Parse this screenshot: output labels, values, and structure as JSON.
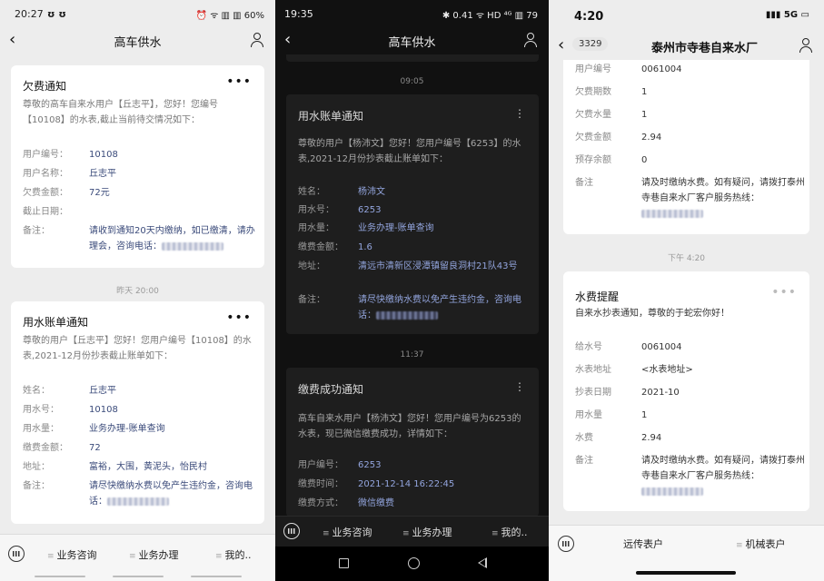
{
  "phone1": {
    "status_time": "20:27",
    "status_left_icons": "ʊ ʊ",
    "status_right": "⏰ ᯤ ▥ ▥ 60%",
    "nav_title": "高车供水",
    "card1": {
      "title": "欠费通知",
      "intro": "尊敬的高车自来水用户【丘志平】，您好！您编号【10108】的水表,截止当前待交情况如下：",
      "rows": [
        {
          "k": "用户编号：",
          "v": "10108"
        },
        {
          "k": "用户名称：",
          "v": "丘志平"
        },
        {
          "k": "欠费金额：",
          "v": "72元"
        },
        {
          "k": "截止日期：",
          "v": ""
        },
        {
          "k": "备注：",
          "v": "请收到通知20天内缴纳，如已缴清，请办理会，咨询电话："
        }
      ]
    },
    "timestamp": "昨天 20:00",
    "card2": {
      "title": "用水账单通知",
      "intro": "尊敬的用户【丘志平】您好！您用户编号【10108】的水表,2021-12月份抄表截止账单如下：",
      "rows": [
        {
          "k": "姓名：",
          "v": "丘志平"
        },
        {
          "k": "用水号：",
          "v": "10108"
        },
        {
          "k": "用水量：",
          "v": "业务办理-账单查询"
        },
        {
          "k": "缴费金额：",
          "v": "72"
        },
        {
          "k": "地址：",
          "v": "富裕，大围，黄泥头，怡民村"
        },
        {
          "k": "备注：",
          "v": "请尽快缴纳水费以免产生违约金，咨询电话："
        }
      ]
    },
    "menus": [
      "业务咨询",
      "业务办理",
      "我的.."
    ]
  },
  "phone2": {
    "status_time": "19:35",
    "status_right": "✱ 0.41 ᯤ HD ⁴ᴳ ▥ 79",
    "nav_title": "高车供水",
    "timestamp1": "09:05",
    "card1": {
      "title": "用水账单通知",
      "intro": "尊敬的用户【杨沛文】您好！您用户编号【6253】的水表,2021-12月份抄表截止账单如下：",
      "rows": [
        {
          "k": "姓名：",
          "v": "杨沛文"
        },
        {
          "k": "用水号：",
          "v": "6253"
        },
        {
          "k": "用水量：",
          "v": "业务办理-账单查询"
        },
        {
          "k": "缴费金额：",
          "v": "1.6"
        },
        {
          "k": "地址：",
          "v": "清远市清新区浸潭镇留良洞村21队43号"
        },
        {
          "k": "备注：",
          "v": "请尽快缴纳水费以免产生违约金，咨询电话："
        }
      ]
    },
    "timestamp2": "11:37",
    "card2": {
      "title": "缴费成功通知",
      "intro": "高车自来水用户【杨沛文】您好！您用户编号为6253的水表，现已微信缴费成功，详情如下：",
      "rows": [
        {
          "k": "用户编号：",
          "v": "6253"
        },
        {
          "k": "缴费时间：",
          "v": "2021-12-14 16:22:45"
        },
        {
          "k": "缴费方式：",
          "v": "微信缴费"
        }
      ]
    },
    "menus": [
      "业务咨询",
      "业务办理",
      "我的.."
    ]
  },
  "phone3": {
    "status_time": "4:20",
    "status_right": "▮▮▮ 5G ▭",
    "badge": "3329",
    "nav_title": "泰州市寺巷自来水厂",
    "card1": {
      "rows": [
        {
          "k": "用户编号",
          "v": "0061004"
        },
        {
          "k": "欠费期数",
          "v": "1"
        },
        {
          "k": "欠费水量",
          "v": "1"
        },
        {
          "k": "欠费金额",
          "v": "2.94"
        },
        {
          "k": "预存余额",
          "v": "0"
        },
        {
          "k": "备注",
          "v": "请及时缴纳水费。如有疑问，请拨打泰州寺巷自来水厂客户服务热线："
        }
      ]
    },
    "timestamp": "下午 4:20",
    "card2": {
      "title": "水费提醒",
      "intro": "自来水抄表通知，尊敬的于蛇宏你好！",
      "rows": [
        {
          "k": "给水号",
          "v": "0061004"
        },
        {
          "k": "水表地址",
          "v": "<水表地址>"
        },
        {
          "k": "抄表日期",
          "v": "2021-10"
        },
        {
          "k": "用水量",
          "v": "1"
        },
        {
          "k": "水费",
          "v": "2.94"
        },
        {
          "k": "备注",
          "v": "请及时缴纳水费。如有疑问，请拨打泰州寺巷自来水厂客户服务热线："
        }
      ]
    },
    "menus": [
      "远传表户",
      "机械表户"
    ]
  }
}
